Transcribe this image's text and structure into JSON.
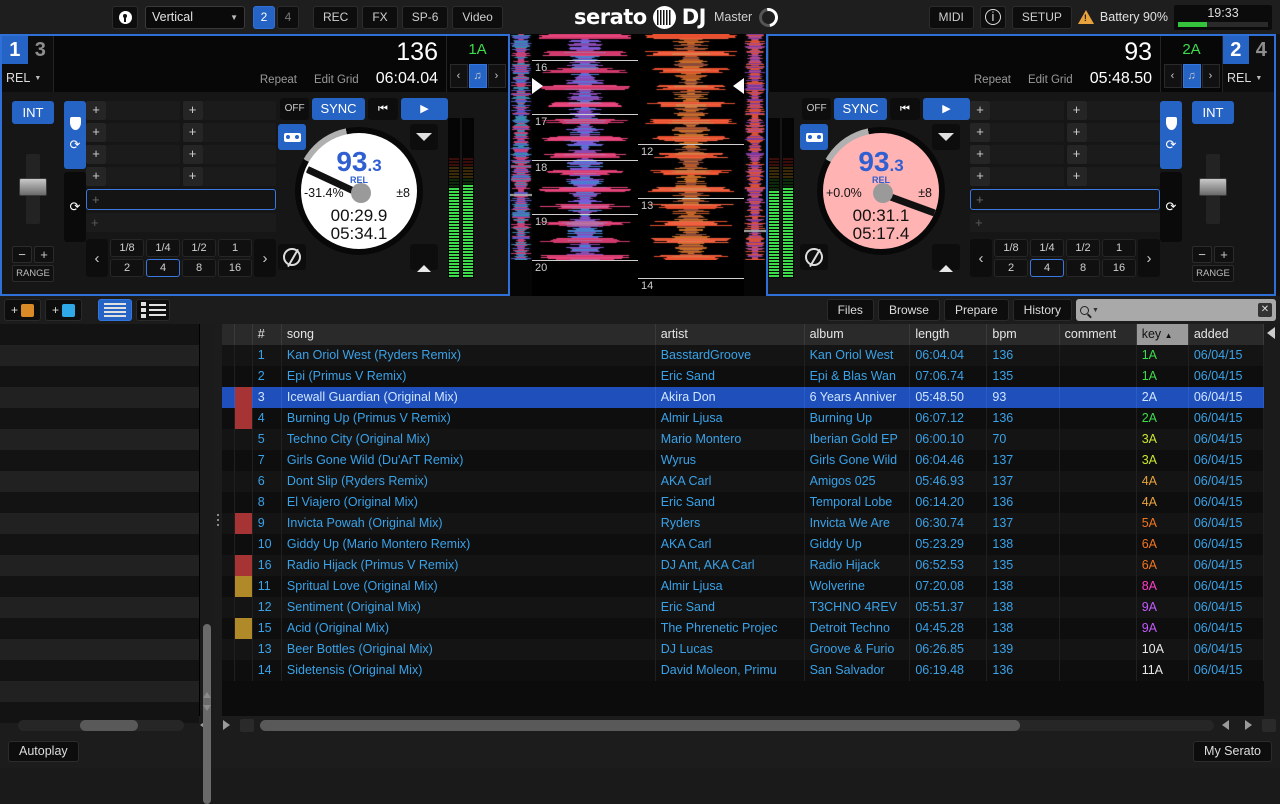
{
  "topbar": {
    "lock_icon": "lock-icon",
    "layout_value": "Vertical",
    "deck_counts": [
      "2",
      "4"
    ],
    "deck_count_active": "2",
    "buttons": [
      "REC",
      "FX",
      "SP-6",
      "Video"
    ],
    "logo_left": "serato",
    "logo_right": "DJ",
    "master_label": "Master",
    "midi_label": "MIDI",
    "info_icon": "info-icon",
    "setup_label": "SETUP",
    "warning_icon": "warning-triangle-icon",
    "battery_label": "Battery 90%",
    "clock": "19:33"
  },
  "deck_left": {
    "deck_num_active": "1",
    "deck_num_inactive": "3",
    "sync_mode": "REL",
    "bpm": "136",
    "repeat_label": "Repeat",
    "edit_grid_label": "Edit Grid",
    "time_total": "06:04.04",
    "key": "1A",
    "int_label": "INT",
    "off_label": "OFF",
    "sync_label": "SYNC",
    "cue_icon": "cue-icon",
    "play_icon": "play-icon",
    "platter_bpm_int": "93",
    "platter_bpm_dec": ".3",
    "platter_rel": "REL",
    "pitch_pct": "-31.4%",
    "pitch_range": "±8",
    "elapsed": "00:29.9",
    "remaining": "05:34.1",
    "keylock_icon": "keylock-icon",
    "censor_icon": "censor-icon",
    "slip_icon": "slip-icon",
    "eject_icon": "eject-icon",
    "range_label": "RANGE",
    "minus_label": "−",
    "plus_label": "+",
    "beat_values": [
      "1/8",
      "1/4",
      "1/2",
      "1",
      "2",
      "4",
      "8",
      "16"
    ],
    "beat_active": "4",
    "cue_plus": "+",
    "loop_plus": "+"
  },
  "deck_right": {
    "deck_num_active": "2",
    "deck_num_inactive": "4",
    "sync_mode": "REL",
    "bpm": "93",
    "repeat_label": "Repeat",
    "edit_grid_label": "Edit Grid",
    "time_total": "05:48.50",
    "key": "2A",
    "int_label": "INT",
    "off_label": "OFF",
    "sync_label": "SYNC",
    "platter_bpm_int": "93",
    "platter_bpm_dec": ".3",
    "platter_rel": "REL",
    "pitch_pct": "+0.0%",
    "pitch_range": "±8",
    "elapsed": "00:31.1",
    "remaining": "05:17.4",
    "range_label": "RANGE",
    "minus_label": "−",
    "plus_label": "+",
    "beat_values": [
      "1/8",
      "1/4",
      "1/2",
      "1",
      "2",
      "4",
      "8",
      "16"
    ],
    "beat_active": "4"
  },
  "waveform": {
    "left_beat_markers": [
      "16",
      "17",
      "18",
      "19",
      "20"
    ],
    "right_beat_markers": [
      "12",
      "13",
      "14"
    ]
  },
  "library": {
    "add_crate_label": "+",
    "add_smartcrate_label": "+",
    "view_list_icon": "list-view-icon",
    "view_detail_icon": "detail-view-icon",
    "tabs": [
      "Files",
      "Browse",
      "Prepare",
      "History"
    ],
    "search_placeholder": "",
    "search_value": "",
    "search_icon": "search-icon",
    "clear_icon": "clear-icon",
    "columns": [
      "#",
      "song",
      "artist",
      "album",
      "length",
      "bpm",
      "comment",
      "key",
      "added"
    ],
    "sorted_column": "key",
    "sort_arrow": "▲",
    "rows": [
      {
        "num": "1",
        "song": "Kan Oriol West (Ryders Remix)",
        "artist": "BasstardGroove",
        "album": "Kan Oriol West",
        "length": "06:04.04",
        "bpm": "136",
        "comment": "",
        "key": "1A",
        "key_class": "key-g",
        "added": "06/04/15",
        "flag": "none"
      },
      {
        "num": "2",
        "song": "Epi (Primus V Remix)",
        "artist": "Eric Sand",
        "album": "Epi & Blas Wan",
        "length": "07:06.74",
        "bpm": "135",
        "comment": "",
        "key": "1A",
        "key_class": "key-g",
        "added": "06/04/15",
        "flag": "none"
      },
      {
        "num": "3",
        "song": "Icewall Guardian (Original Mix)",
        "artist": "Akira Don",
        "album": "6 Years Anniver",
        "length": "05:48.50",
        "bpm": "93",
        "comment": "",
        "key": "2A",
        "key_class": "key-g",
        "added": "06/04/15",
        "flag": "red",
        "selected": true
      },
      {
        "num": "4",
        "song": "Burning Up (Primus V Remix)",
        "artist": "Almir Ljusa",
        "album": "Burning Up",
        "length": "06:07.12",
        "bpm": "136",
        "comment": "",
        "key": "2A",
        "key_class": "key-g",
        "added": "06/04/15",
        "flag": "red"
      },
      {
        "num": "5",
        "song": "Techno City (Original Mix)",
        "artist": "Mario Montero",
        "album": "Iberian Gold EP",
        "length": "06:00.10",
        "bpm": "70",
        "comment": "",
        "key": "3A",
        "key_class": "key-y",
        "added": "06/04/15",
        "flag": "none"
      },
      {
        "num": "7",
        "song": "Girls Gone Wild (Du'ArT Remix)",
        "artist": "Wyrus",
        "album": "Girls Gone Wild",
        "length": "06:04.46",
        "bpm": "137",
        "comment": "",
        "key": "3A",
        "key_class": "key-y",
        "added": "06/04/15",
        "flag": "none"
      },
      {
        "num": "6",
        "song": "Dont Slip (Ryders Remix)",
        "artist": "AKA Carl",
        "album": "Amigos 025",
        "length": "05:46.93",
        "bpm": "137",
        "comment": "",
        "key": "4A",
        "key_class": "key-o",
        "added": "06/04/15",
        "flag": "none"
      },
      {
        "num": "8",
        "song": "El Viajero (Original Mix)",
        "artist": "Eric Sand",
        "album": "Temporal Lobe",
        "length": "06:14.20",
        "bpm": "136",
        "comment": "",
        "key": "4A",
        "key_class": "key-o",
        "added": "06/04/15",
        "flag": "none"
      },
      {
        "num": "9",
        "song": "Invicta Powah (Original Mix)",
        "artist": "Ryders",
        "album": "Invicta We Are",
        "length": "06:30.74",
        "bpm": "137",
        "comment": "",
        "key": "5A",
        "key_class": "key-or",
        "added": "06/04/15",
        "flag": "red"
      },
      {
        "num": "10",
        "song": "Giddy Up (Mario Montero Remix)",
        "artist": "AKA Carl",
        "album": "Giddy Up",
        "length": "05:23.29",
        "bpm": "138",
        "comment": "",
        "key": "6A",
        "key_class": "key-or",
        "added": "06/04/15",
        "flag": "none"
      },
      {
        "num": "16",
        "song": "Radio Hijack (Primus V Remix)",
        "artist": "DJ Ant, AKA Carl",
        "album": "Radio Hijack",
        "length": "06:52.53",
        "bpm": "135",
        "comment": "",
        "key": "6A",
        "key_class": "key-or",
        "added": "06/04/15",
        "flag": "red"
      },
      {
        "num": "11",
        "song": "Spritual Love (Original Mix)",
        "artist": "Almir Ljusa",
        "album": "Wolverine",
        "length": "07:20.08",
        "bpm": "138",
        "comment": "",
        "key": "8A",
        "key_class": "key-p",
        "added": "06/04/15",
        "flag": "gold"
      },
      {
        "num": "12",
        "song": "Sentiment (Original Mix)",
        "artist": "Eric Sand",
        "album": "T3CHNO 4REV",
        "length": "05:51.37",
        "bpm": "138",
        "comment": "",
        "key": "9A",
        "key_class": "key-v",
        "added": "06/04/15",
        "flag": "none"
      },
      {
        "num": "15",
        "song": "Acid (Original Mix)",
        "artist": "The Phrenetic Projec",
        "album": "Detroit Techno",
        "length": "04:45.28",
        "bpm": "138",
        "comment": "",
        "key": "9A",
        "key_class": "key-v",
        "added": "06/04/15",
        "flag": "gold"
      },
      {
        "num": "13",
        "song": "Beer Bottles (Original Mix)",
        "artist": "DJ Lucas",
        "album": "Groove & Furio",
        "length": "06:26.85",
        "bpm": "139",
        "comment": "",
        "key": "10A",
        "key_class": "key-w",
        "added": "06/04/15",
        "flag": "none"
      },
      {
        "num": "14",
        "song": "Sidetensis (Original Mix)",
        "artist": "David Moleon, Primu",
        "album": "San Salvador",
        "length": "06:19.48",
        "bpm": "136",
        "comment": "",
        "key": "11A",
        "key_class": "key-w",
        "added": "06/04/15",
        "flag": "none"
      }
    ]
  },
  "statusbar": {
    "autoplay_label": "Autoplay",
    "myserato_label": "My Serato"
  },
  "colors": {
    "accent_blue": "#2563c4",
    "link_blue": "#3aa2e8",
    "select_blue": "#1f4fbb",
    "green_key": "#3ddc4a",
    "battery_green": "#35c23d",
    "warn_orange": "#e8a33d"
  }
}
